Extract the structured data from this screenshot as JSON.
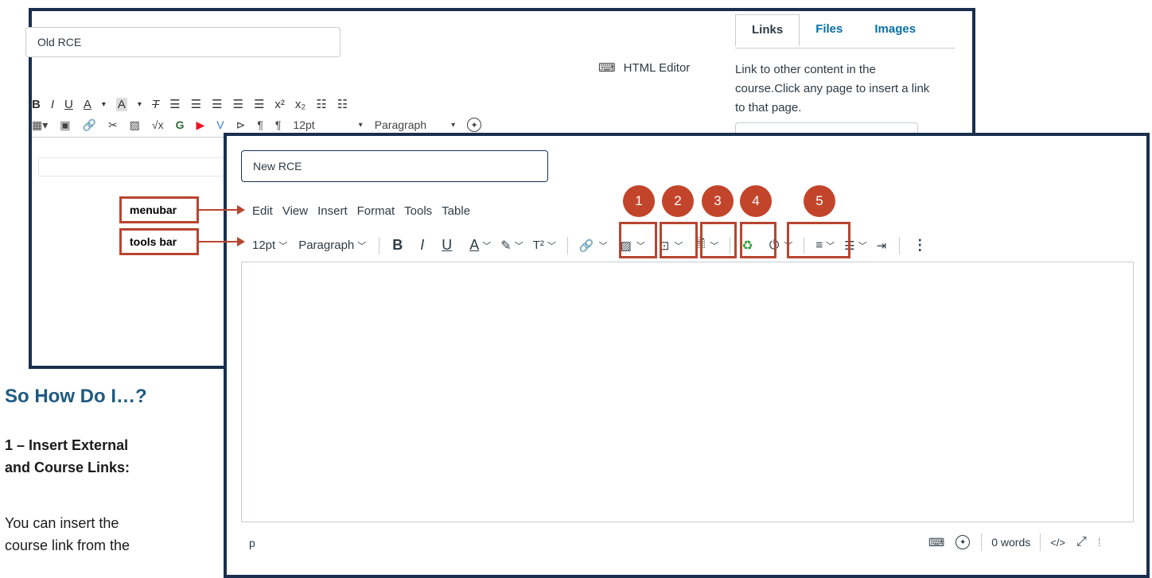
{
  "old_rce": {
    "title_value": "Old RCE",
    "html_editor_label": "HTML Editor",
    "font_size": "12pt",
    "block_format": "Paragraph",
    "tabs": [
      "Links",
      "Files",
      "Images"
    ],
    "sidebar_text": "Link to other content in the course.Click any page to insert a link to that page."
  },
  "new_rce": {
    "title_value": "New RCE",
    "menubar": [
      "Edit",
      "View",
      "Insert",
      "Format",
      "Tools",
      "Table"
    ],
    "font_size": "12pt",
    "block_format": "Paragraph",
    "status_path": "p",
    "word_count": "0 words",
    "html_toggle": "</>"
  },
  "callouts": {
    "menubar": "menubar",
    "toolsbar": "tools bar"
  },
  "numbers": [
    "1",
    "2",
    "3",
    "4",
    "5"
  ],
  "doc": {
    "heading": "So How Do I…?",
    "step_title_line1": "1 – Insert External",
    "step_title_line2": "and Course Links:",
    "body_line1": "You can insert the",
    "body_line2": "course link from the"
  },
  "colors": {
    "panel_border": "#1a2f4f",
    "annotation": "#b84530",
    "badge": "#c2452b",
    "heading": "#1f5a83",
    "link": "#0770a3"
  }
}
